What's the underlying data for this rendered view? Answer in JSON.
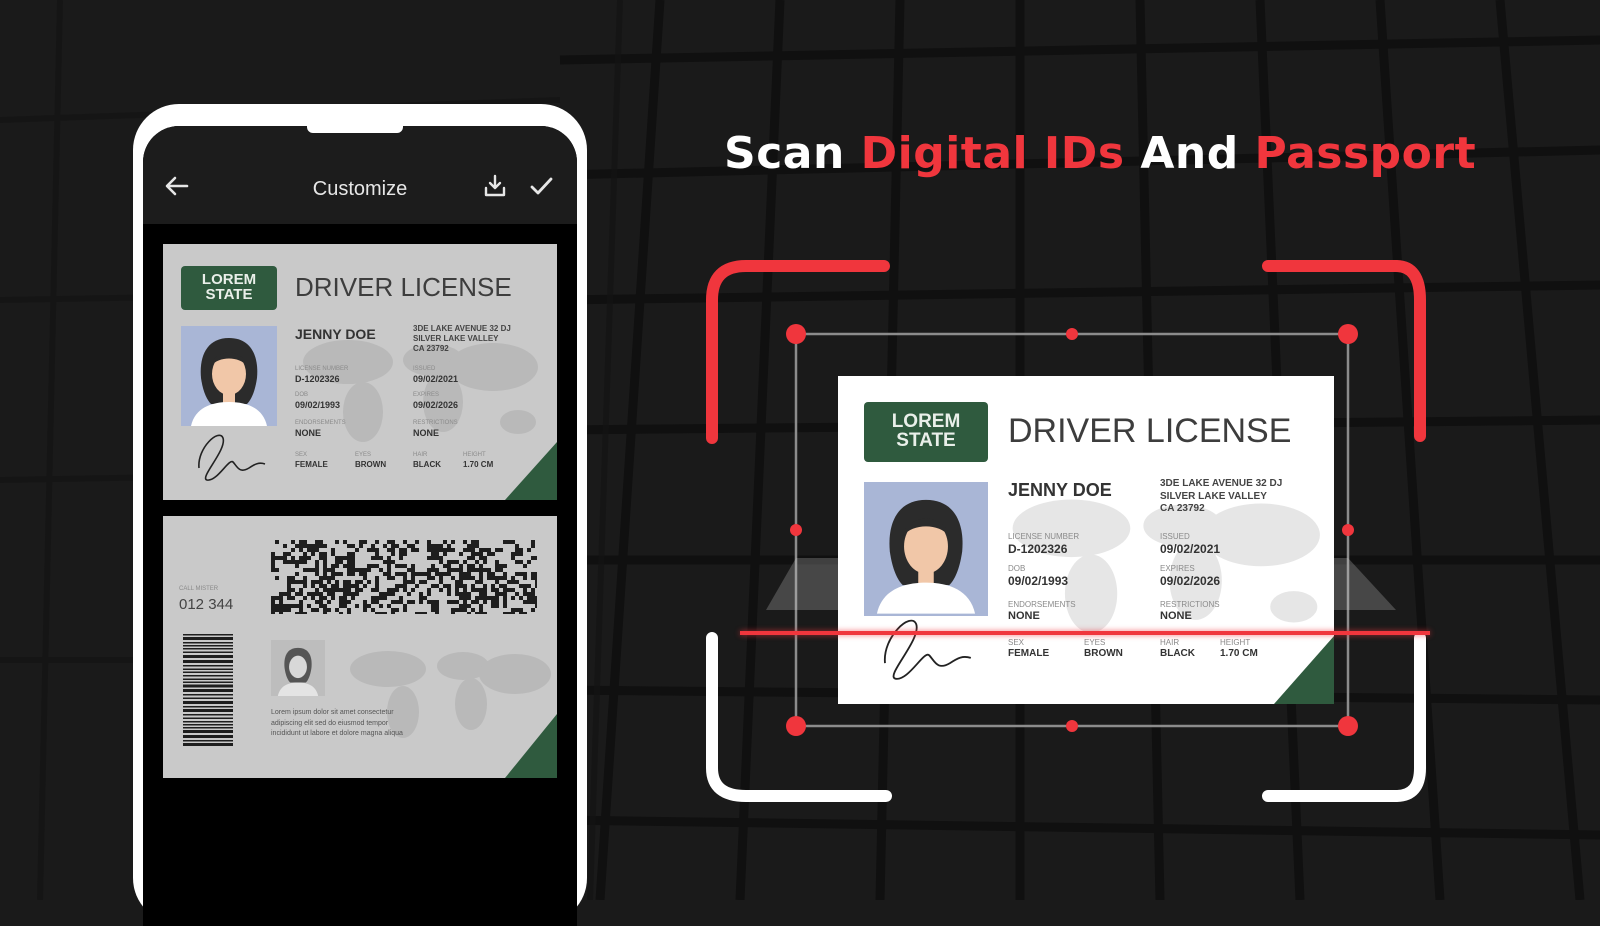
{
  "headline": {
    "part1": "Scan ",
    "part2": "Digital IDs",
    "part3": " And ",
    "part4": "Passport"
  },
  "colors": {
    "background": "#1a1a1a",
    "accent_red": "#f0363d",
    "badge_green": "#2f5a3e",
    "card_gray": "#c9c9c9"
  },
  "app_bar": {
    "title": "Customize",
    "back_icon": "arrow-left-icon",
    "download_icon": "download-icon",
    "confirm_icon": "check-icon"
  },
  "license_front": {
    "state_line1": "LOREM",
    "state_line2": "STATE",
    "title": "DRIVER LICENSE",
    "holder_name": "JENNY DOE",
    "address_line1": "3DE LAKE AVENUE 32 DJ",
    "address_line2": "SILVER LAKE VALLEY",
    "address_line3": "CA 23792",
    "license_number_label": "LICENSE NUMBER",
    "license_number": "D-1202326",
    "issued_label": "ISSUED",
    "issued": "09/02/2021",
    "dob_label": "DOB",
    "dob": "09/02/1993",
    "expires_label": "EXPIRES",
    "expires": "09/02/2026",
    "endorsements_label": "ENDORSEMENTS",
    "endorsements": "NONE",
    "restrictions_label": "RESTRICTIONS",
    "restrictions": "NONE",
    "sex_label": "SEX",
    "sex": "FEMALE",
    "eyes_label": "EYES",
    "eyes": "BROWN",
    "hair_label": "HAIR",
    "hair": "BLACK",
    "height_label": "HEIGHT",
    "height": "1.70 CM"
  },
  "license_back": {
    "id_label": "CALL MISTER",
    "id_number": "012 344",
    "fine_print_line1": "Lorem ipsum dolor sit amet consectetur",
    "fine_print_line2": "adipiscing elit sed do eiusmod tempor",
    "fine_print_line3": "incididunt ut labore et dolore magna aliqua"
  }
}
